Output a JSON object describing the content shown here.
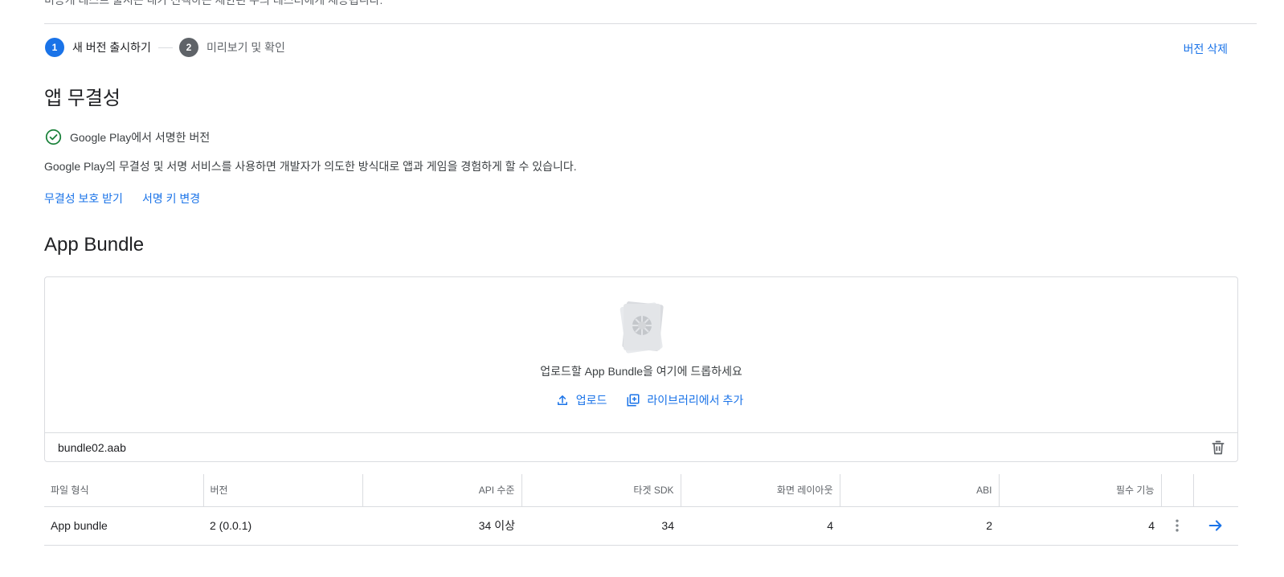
{
  "top_cut_text": "비공개 테스트 출시는 내가 선택하는 제한된 수의 테스터에게 제공됩니다.",
  "stepper": {
    "steps": [
      {
        "num": "1",
        "label": "새 버전 출시하기"
      },
      {
        "num": "2",
        "label": "미리보기 및 확인"
      }
    ]
  },
  "delete_release_label": "버전 삭제",
  "integrity": {
    "title": "앱 무결성",
    "status": "Google Play에서 서명한 버전",
    "description": "Google Play의 무결성 및 서명 서비스를 사용하면 개발자가 의도한 방식대로 앱과 게임을 경험하게 할 수 있습니다.",
    "links": [
      "무결성 보호 받기",
      "서명 키 변경"
    ]
  },
  "bundle": {
    "title": "App Bundle",
    "drop_text": "업로드할 App Bundle을 여기에 드롭하세요",
    "upload_label": "업로드",
    "library_label": "라이브러리에서 추가",
    "file_name": "bundle02.aab"
  },
  "table": {
    "headers": [
      "파일 형식",
      "버전",
      "API 수준",
      "타겟 SDK",
      "화면 레이아웃",
      "ABI",
      "필수 기능"
    ],
    "rows": [
      [
        "App bundle",
        "2 (0.0.1)",
        "34 이상",
        "34",
        "4",
        "2",
        "4"
      ]
    ]
  },
  "colors": {
    "accent": "#1a73e8",
    "success": "#188038",
    "text": "#202124",
    "secondary_text": "#5f6368",
    "divider": "#dadce0"
  }
}
